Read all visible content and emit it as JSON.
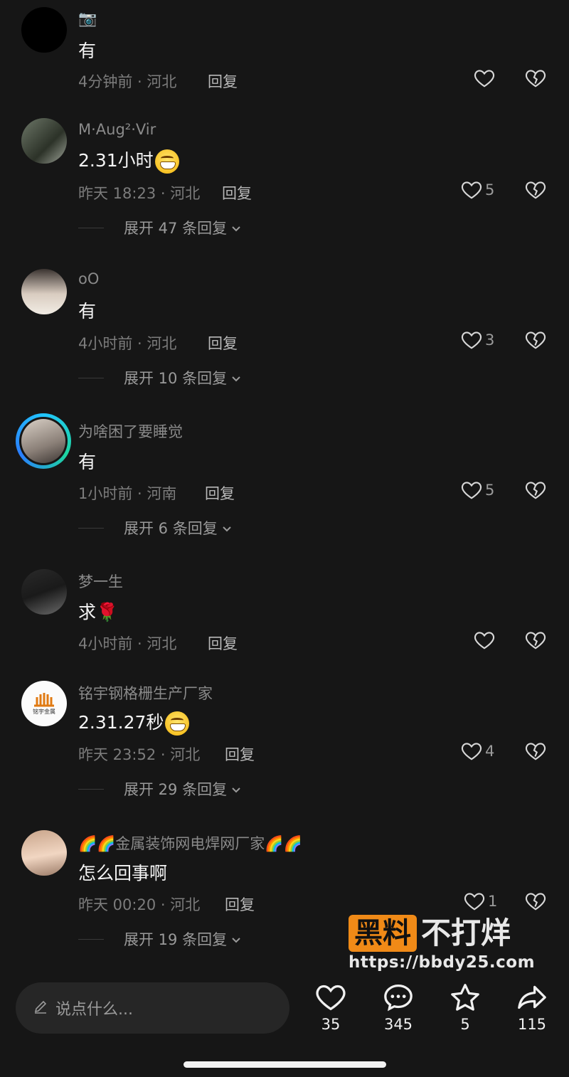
{
  "comments": [
    {
      "username": "📷",
      "text": "有",
      "time": "4分钟前",
      "location": "河北",
      "reply": "回复",
      "likes": "",
      "expand": ""
    },
    {
      "username": "M·Aug²·Vir",
      "text": "2.31小时",
      "time": "昨天 18:23",
      "location": "河北",
      "reply": "回复",
      "likes": "5",
      "expand": "展开 47 条回复"
    },
    {
      "username": "oO",
      "text": "有",
      "time": "4小时前",
      "location": "河北",
      "reply": "回复",
      "likes": "3",
      "expand": "展开 10 条回复"
    },
    {
      "username": "为啥困了要睡觉",
      "text": "有",
      "time": "1小时前",
      "location": "河南",
      "reply": "回复",
      "likes": "5",
      "expand": "展开 6 条回复"
    },
    {
      "username": "梦一生",
      "text": "求🌹",
      "time": "4小时前",
      "location": "河北",
      "reply": "回复",
      "likes": "",
      "expand": ""
    },
    {
      "username": "铭宇钢格栅生产厂家",
      "text": "2.31.27秒",
      "time": "昨天 23:52",
      "location": "河北",
      "reply": "回复",
      "likes": "4",
      "expand": "展开 29 条回复"
    },
    {
      "username": "🌈🌈金属装饰网电焊网厂家🌈🌈",
      "text": "怎么回事啊",
      "time": "昨天 00:20",
      "location": "河北",
      "reply": "回复",
      "likes": "1",
      "expand": "展开 19 条回复"
    }
  ],
  "avatar_logo_text": "铭宇金属",
  "input": {
    "placeholder": "说点什么..."
  },
  "actions": {
    "likes": "35",
    "comments": "345",
    "favorites": "5",
    "shares": "115"
  },
  "watermark": {
    "box": "黑料",
    "rest": "不打烊",
    "url": "https://bbdy25.com"
  },
  "colors": {
    "background": "#161616",
    "accent": "#f08a17"
  }
}
